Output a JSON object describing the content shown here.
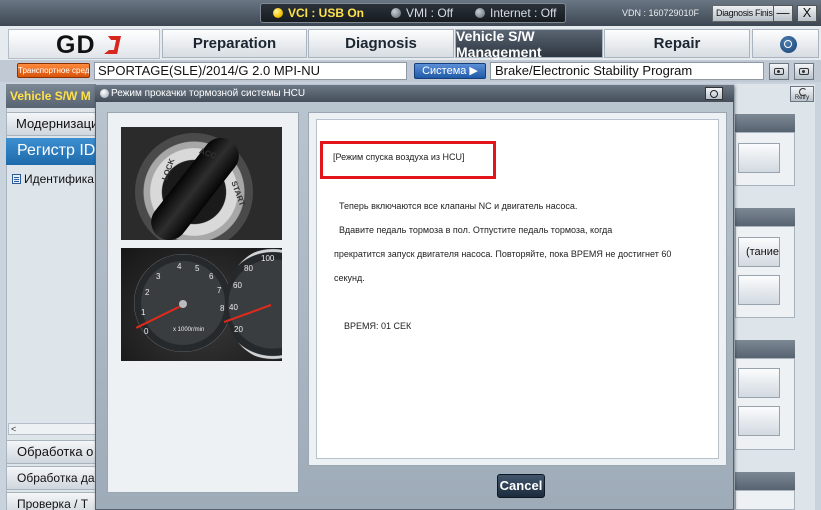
{
  "status_bar": {
    "vci": "VCI : USB On",
    "vmi": "VMI : Off",
    "internet": "Internet : Off",
    "vdn": "VDN : 160729010F",
    "diagnosis_finish": "Diagnosis Finish",
    "minimize": "—",
    "close": "X"
  },
  "logo": {
    "text": "GD"
  },
  "tabs": [
    "Preparation",
    "Diagnosis",
    "Vehicle S/W Management",
    "Repair"
  ],
  "vehicle_row": {
    "vehicle_label": "Транспортное средство",
    "vehicle_value": "SPORTAGE(SLE)/2014/G 2.0 MPI-NU",
    "system_button": "Система ▶",
    "system_value": "Brake/Electronic Stability Program"
  },
  "left_panel": {
    "title": "Vehicle S/W M",
    "items": [
      "Модернизация",
      "Регистр ID",
      "Идентифика"
    ],
    "scroll_arrow": "<",
    "bottom_items": [
      "Обработка о",
      "Обработка дан",
      "Проверка / Т"
    ]
  },
  "right_panel": {
    "retry": "Retry",
    "button_partial": "тание)"
  },
  "modal": {
    "title": "Режим прокачки тормозной системы HCU",
    "highlight_heading": "[Режим спуска воздуха из HCU]",
    "lines": [
      "Теперь включаются все клапаны NC и двигатель насоса.",
      "Вдавите педаль тормоза в пол. Отпустите педаль тормоза, когда",
      "прекратится запуск двигателя насоса. Повторяйте, пока ВРЕМЯ не достигнет 60",
      "секунд."
    ],
    "time": "ВРЕМЯ: 01 СЕК",
    "cancel": "Cancel"
  },
  "images": {
    "ignition_labels": [
      "LOCK",
      "ACC",
      "START"
    ],
    "rpm_numbers": [
      "0",
      "1",
      "2",
      "3",
      "4",
      "5",
      "6",
      "7",
      "8"
    ],
    "rpm_unit": "x 1000r/min",
    "speed_numbers": [
      "20",
      "40",
      "60",
      "80",
      "100"
    ]
  },
  "colors": {
    "highlight_border": "#e2151b",
    "vci_on": "#ffe24a",
    "active_tab": "#3a4450",
    "register_blue": "#2a7bbf"
  }
}
